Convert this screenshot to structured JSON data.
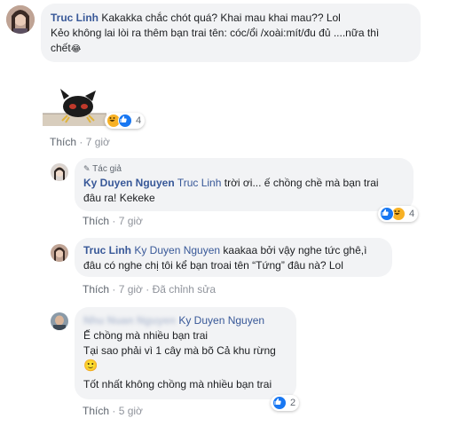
{
  "comments": [
    {
      "author": "Truc Linh",
      "line1": "Kakakka chắc chót quá? Khai mau khai mau?? Lol",
      "line2": "Kẻo không lai lòi ra thêm bạn trai tên: cóc/ổi /xoài:mít/đu đủ ....nữa thì",
      "line3": "chết",
      "line3_emoji": "😂",
      "reaction_count": "4",
      "meta_action": "Thích",
      "meta_time": "7 giờ"
    },
    {
      "badge": "Tác giả",
      "author": "Ky Duyen Nguyen",
      "tag": "Truc Linh",
      "line1_rest": "trời ơi... ế chồng chề mà bạn trai",
      "line2": "đâu ra! Kekeke",
      "reaction_count": "4",
      "meta_action": "Thích",
      "meta_time": "7 giờ"
    },
    {
      "author": "Truc Linh",
      "tag": "Ky Duyen Nguyen",
      "line1_rest": "kaakaa bởi vậy nghe tức ghê,ì",
      "line2": "đâu có nghe chị tôi kể bạn troai tên “Tứng” đâu nà? Lol",
      "meta_action": "Thích",
      "meta_time": "7 giờ",
      "meta_edited": "Đã chỉnh sửa"
    },
    {
      "author_blurred": "Nhu Nuan Nguyen",
      "tag": "Ky Duyen Nguyen",
      "line1": "Ế chồng mà nhiều bạn trai",
      "line2": "Tại sao phải vì 1 cây mà bõ Cả khu rừng",
      "line3_emoji": "🙂",
      "line4": "Tốt nhất không chồng mà nhiều bạn trai",
      "reaction_count": "2",
      "meta_action": "Thích",
      "meta_time": "5 giờ"
    }
  ],
  "separator": "·",
  "colors": {
    "link": "#385898",
    "bubble": "#f2f3f5",
    "like": "#1877f2",
    "haha": "#f7b125"
  }
}
